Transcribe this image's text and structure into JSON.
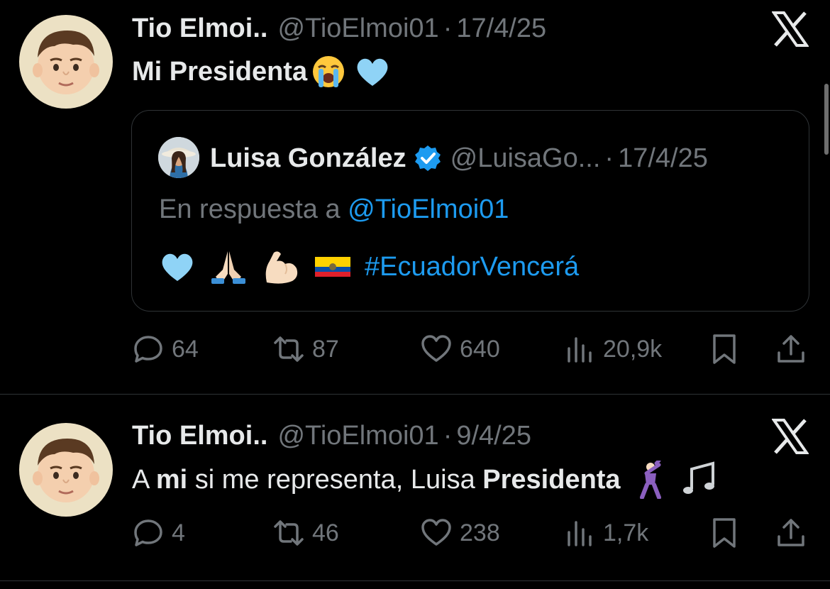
{
  "tweets": [
    {
      "author_name": "Tio Elmoi..",
      "handle": "@TioElmoi01",
      "separator": "·",
      "date": "17/4/25",
      "text_main": "Mi Presidenta",
      "emojis": [
        "loudly-crying-face",
        "light-blue-heart"
      ],
      "quote": {
        "author_name": "Luisa González",
        "verified": true,
        "handle": "@LuisaGo...",
        "separator": "·",
        "date": "17/4/25",
        "reply_prefix": "En respuesta a",
        "reply_mention": "@TioElmoi01",
        "emojis": [
          "light-blue-heart",
          "folded-hands",
          "flexed-biceps",
          "ecuador-flag"
        ],
        "hashtag": "#EcuadorVencerá"
      },
      "stats": {
        "replies": "64",
        "retweets": "87",
        "likes": "640",
        "views": "20,9k"
      }
    },
    {
      "author_name": "Tio Elmoi..",
      "handle": "@TioElmoi01",
      "separator": "·",
      "date": "9/4/25",
      "text_parts": [
        "A ",
        "mi",
        " si me representa, Luisa ",
        "Presidenta"
      ],
      "emojis": [
        "man-dancing",
        "musical-notes"
      ],
      "stats": {
        "replies": "4",
        "retweets": "46",
        "likes": "238",
        "views": "1,7k"
      }
    }
  ],
  "colors": {
    "background": "#000000",
    "text": "#e7e9ea",
    "muted": "#71767b",
    "link": "#1d9bf0",
    "border": "#2f3336"
  }
}
